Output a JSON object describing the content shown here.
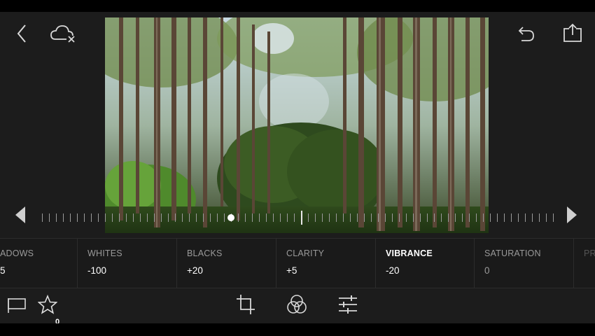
{
  "top_bar": {
    "back_icon": "chevron-left-icon",
    "cloud_icon": "cloud-sync-off-icon",
    "undo_icon": "undo-icon",
    "share_icon": "share-icon"
  },
  "photo": {
    "description_icon": "forest-photo"
  },
  "slider": {
    "value_fraction": 0.37
  },
  "adjustments": [
    {
      "label": "ADOWS",
      "value": "5",
      "active": false
    },
    {
      "label": "WHITES",
      "value": "-100",
      "active": false
    },
    {
      "label": "BLACKS",
      "value": "+20",
      "active": false
    },
    {
      "label": "CLARITY",
      "value": "+5",
      "active": false
    },
    {
      "label": "VIBRANCE",
      "value": "-20",
      "active": true
    },
    {
      "label": "SATURATION",
      "value": "0",
      "active": false
    },
    {
      "label": "PR",
      "value": "",
      "active": false
    }
  ],
  "bottom_bar": {
    "flag_icon": "flag-icon",
    "star_icon": "star-icon",
    "star_count": "0",
    "crop_icon": "crop-icon",
    "color_icon": "color-circles-icon",
    "adjust_icon": "sliders-icon"
  },
  "colors": {
    "panel_bg": "#1c1c1c",
    "accent_text": "#ffffff",
    "muted_text": "#9a9a9a"
  }
}
